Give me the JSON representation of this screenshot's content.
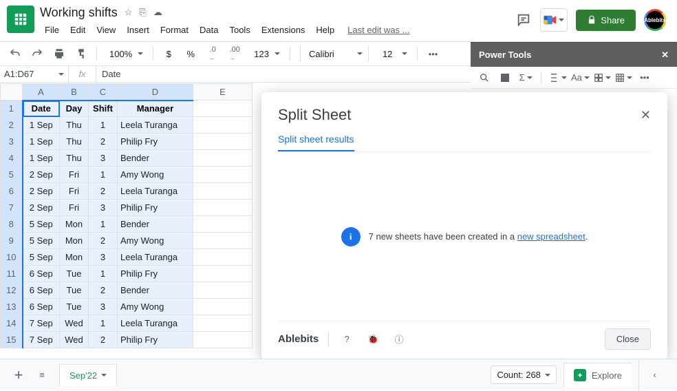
{
  "doc_title": "Working shifts",
  "menu": [
    "File",
    "Edit",
    "View",
    "Insert",
    "Format",
    "Data",
    "Tools",
    "Extensions",
    "Help"
  ],
  "last_edit": "Last edit was ...",
  "share_label": "Share",
  "account_label": "Ablebits",
  "toolbar": {
    "zoom": "100%",
    "currency": "$",
    "percent": "%",
    "dec_minus": ".0",
    "dec_plus": ".00",
    "num_fmt_label": "123",
    "font": "Calibri",
    "font_size": "12"
  },
  "sidebar": {
    "title": "Power Tools"
  },
  "name_box": "A1:D67",
  "formula_value": "Date",
  "columns": [
    "A",
    "B",
    "C",
    "D",
    "E"
  ],
  "headers": [
    "Date",
    "Day",
    "Shift",
    "Manager"
  ],
  "rows": [
    [
      "1 Sep",
      "Thu",
      "1",
      "Leela Turanga"
    ],
    [
      "1 Sep",
      "Thu",
      "2",
      "Philip Fry"
    ],
    [
      "1 Sep",
      "Thu",
      "3",
      "Bender"
    ],
    [
      "2 Sep",
      "Fri",
      "1",
      "Amy Wong"
    ],
    [
      "2 Sep",
      "Fri",
      "2",
      "Leela Turanga"
    ],
    [
      "2 Sep",
      "Fri",
      "3",
      "Philip Fry"
    ],
    [
      "5 Sep",
      "Mon",
      "1",
      "Bender"
    ],
    [
      "5 Sep",
      "Mon",
      "2",
      "Amy Wong"
    ],
    [
      "5 Sep",
      "Mon",
      "3",
      "Leela Turanga"
    ],
    [
      "6 Sep",
      "Tue",
      "1",
      "Philip Fry"
    ],
    [
      "6 Sep",
      "Tue",
      "2",
      "Bender"
    ],
    [
      "6 Sep",
      "Tue",
      "3",
      "Amy Wong"
    ],
    [
      "7 Sep",
      "Wed",
      "1",
      "Leela Turanga"
    ],
    [
      "7 Sep",
      "Wed",
      "2",
      "Philip Fry"
    ]
  ],
  "dialog": {
    "title": "Split Sheet",
    "tab": "Split sheet results",
    "message_pre": "7 new sheets have been created in a ",
    "link_text": "new spreadsheet",
    "message_post": ".",
    "brand": "Ablebits",
    "close": "Close"
  },
  "tabbar": {
    "sheet_name": "Sep'22",
    "count_label": "Count: 268",
    "explore": "Explore"
  }
}
